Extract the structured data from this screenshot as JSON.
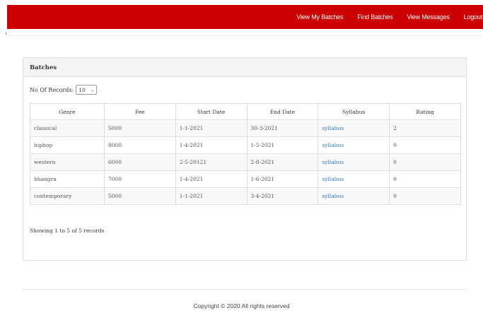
{
  "nav": {
    "links": [
      "View My Batches",
      "Find Batches",
      "View Messages",
      "Logout"
    ]
  },
  "panel": {
    "title": "Batches",
    "records_label": "No Of Records:",
    "records_value": "10",
    "table": {
      "headers": [
        "Genre",
        "Fee",
        "Start Date",
        "End Date",
        "Syllabus",
        "Rating"
      ],
      "rows": [
        [
          "classical",
          "5000",
          "1-1-2021",
          "30-3-2021",
          "syllabus",
          "2"
        ],
        [
          "hiphop",
          "8000",
          "1-4-2021",
          "1-5-2021",
          "syllabus",
          "0"
        ],
        [
          "western",
          "6000",
          "2-5-20121",
          "2-8-2021",
          "syllabus",
          "0"
        ],
        [
          "bhangra",
          "7000",
          "1-4-2021",
          "1-6-2021",
          "syllabus",
          "0"
        ],
        [
          "contemporary",
          "5000",
          "1-1-2021",
          "3-4-2021",
          "syllabus",
          "0"
        ]
      ]
    },
    "showing": "Showing 1 to 5 of 5 records"
  },
  "footer": {
    "copyright": "Copyright © 2020 All rights reserved"
  },
  "colors": {
    "brand": "#cc0000",
    "link": "#337ab7"
  }
}
